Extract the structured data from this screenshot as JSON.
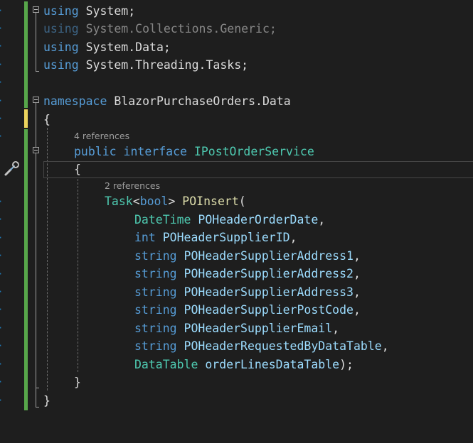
{
  "editor": {
    "lines": {
      "using1": {
        "kw": "using",
        "rest": " System;"
      },
      "using2": {
        "kw": "using",
        "rest": " System.Collections.Generic;"
      },
      "using3": {
        "kw": "using",
        "rest": " System.Data;"
      },
      "using4": {
        "kw": "using",
        "rest": " System.Threading.Tasks;"
      },
      "namespace": {
        "kw": "namespace",
        "name": " BlazorPurchaseOrders.Data"
      },
      "open_brace_ns": "{",
      "codelens_interface": "4 references",
      "interface_decl": {
        "kw1": "public",
        "kw2": " interface",
        "name": " IPostOrderService"
      },
      "open_brace_if": "{",
      "codelens_method": "2 references",
      "method_sig": {
        "type": "Task",
        "lt": "<",
        "kw": "bool",
        "gt": ">",
        "name": " POInsert",
        "paren": "("
      },
      "params": [
        {
          "type": "DateTime",
          "name": " POHeaderOrderDate",
          "end": ","
        },
        {
          "type": "int",
          "name": " POHeaderSupplierID",
          "end": ","
        },
        {
          "type": "string",
          "name": " POHeaderSupplierAddress1",
          "end": ","
        },
        {
          "type": "string",
          "name": " POHeaderSupplierAddress2",
          "end": ","
        },
        {
          "type": "string",
          "name": " POHeaderSupplierAddress3",
          "end": ","
        },
        {
          "type": "string",
          "name": " POHeaderSupplierPostCode",
          "end": ","
        },
        {
          "type": "string",
          "name": " POHeaderSupplierEmail",
          "end": ","
        },
        {
          "type": "string",
          "name": " POHeaderRequestedByDataTable",
          "end": ","
        },
        {
          "type": "DataTable",
          "name": " orderLinesDataTable",
          "end": ");"
        }
      ],
      "close_brace_if": "}",
      "close_brace_ns": "}"
    }
  },
  "colors": {
    "background": "#1e1e1e",
    "keyword": "#569cd6",
    "type": "#4ec9b0",
    "identifier": "#dcdcdc",
    "parameter": "#9cdcfe",
    "method": "#dcdcaa",
    "codelens": "#9d9d9d",
    "change_saved": "#57a64a",
    "change_unsaved": "#ebd35d"
  },
  "icons": {
    "quick_actions": "screwdriver-wrench-icon",
    "collapse": "collapse-minus-icon"
  }
}
